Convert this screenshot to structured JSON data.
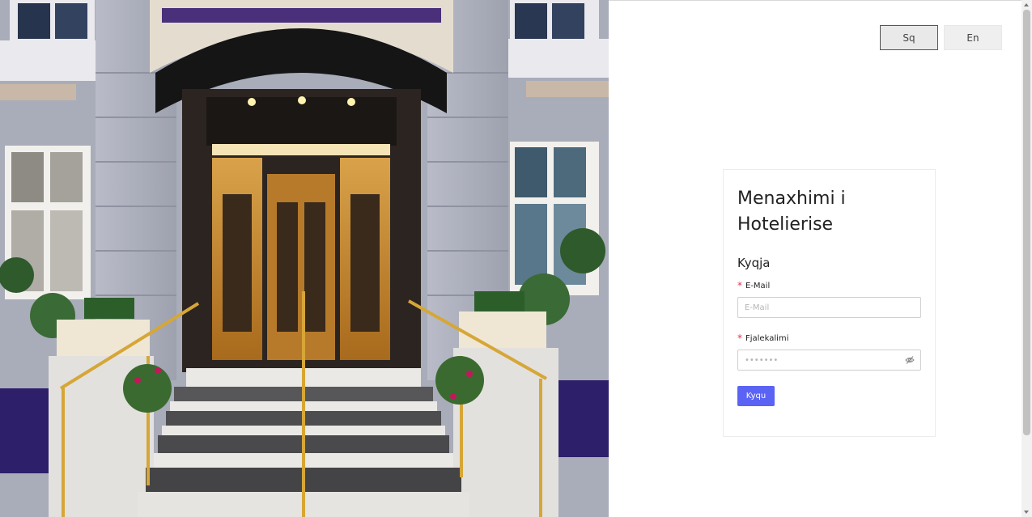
{
  "hero": {
    "image": "hotel-entrance-photo"
  },
  "lang": {
    "sq": "Sq",
    "en": "En",
    "selected": "Sq"
  },
  "card": {
    "title": "Menaxhimi i Hotelierise",
    "subtitle": "Kyqja",
    "email": {
      "label": "E-Mail",
      "placeholder": "E-Mail",
      "value": "",
      "required": "*"
    },
    "password": {
      "label": "Fjalekalimi",
      "placeholder": "•••••••",
      "value": "",
      "required": "*",
      "icon": "eye-off-icon"
    },
    "login_label": "Kyqu"
  },
  "colors": {
    "accent": "#5b63f5",
    "required": "#e0344b"
  }
}
